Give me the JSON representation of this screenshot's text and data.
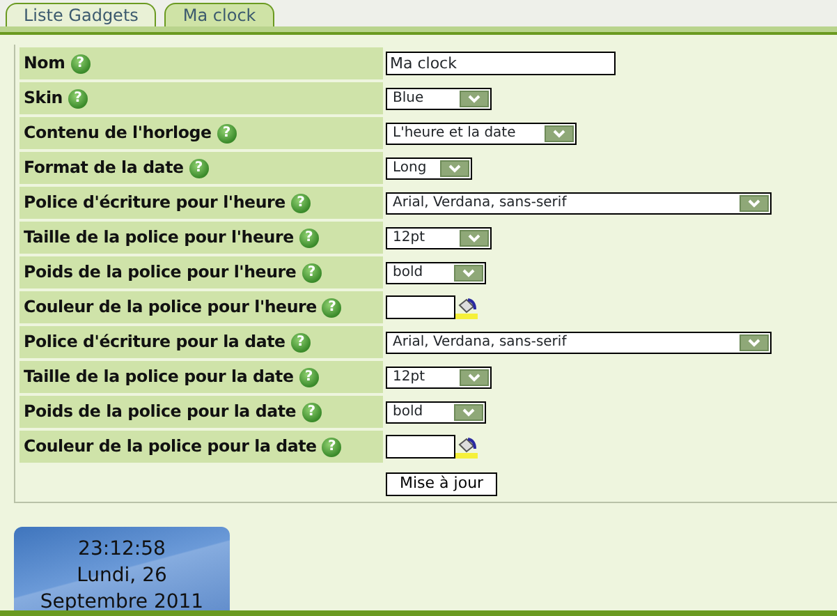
{
  "tabs": [
    {
      "label": "Liste Gadgets",
      "selected": false
    },
    {
      "label": "Ma clock",
      "selected": true
    }
  ],
  "form": {
    "rows": [
      {
        "label": "Nom",
        "help": "?",
        "kind": "text",
        "value": "Ma clock"
      },
      {
        "label": "Skin",
        "help": "?",
        "kind": "select",
        "value": "Blue"
      },
      {
        "label": "Contenu de l'horloge",
        "help": "?",
        "kind": "select",
        "value": "L'heure et la date"
      },
      {
        "label": "Format de la date",
        "help": "?",
        "kind": "select",
        "value": "Long"
      },
      {
        "label": "Police d'écriture pour l'heure",
        "help": "?",
        "kind": "select",
        "value": "Arial, Verdana, sans-serif"
      },
      {
        "label": "Taille de la police pour l'heure",
        "help": "?",
        "kind": "select",
        "value": "12pt"
      },
      {
        "label": "Poids de la police pour l'heure",
        "help": "?",
        "kind": "select",
        "value": "bold"
      },
      {
        "label": "Couleur de la police pour l'heure",
        "help": "?",
        "kind": "color"
      },
      {
        "label": "Police d'écriture pour la date",
        "help": "?",
        "kind": "select",
        "value": "Arial, Verdana, sans-serif"
      },
      {
        "label": "Taille de la police pour la date",
        "help": "?",
        "kind": "select",
        "value": "12pt"
      },
      {
        "label": "Poids de la police pour la date",
        "help": "?",
        "kind": "select",
        "value": "bold"
      },
      {
        "label": "Couleur de la police pour la date",
        "help": "?",
        "kind": "color"
      }
    ],
    "submit": "Mise à jour"
  },
  "clock": {
    "time": "23:12:58",
    "date_line_1": "Lundi, 26",
    "date_line_2": "Septembre 2011"
  }
}
